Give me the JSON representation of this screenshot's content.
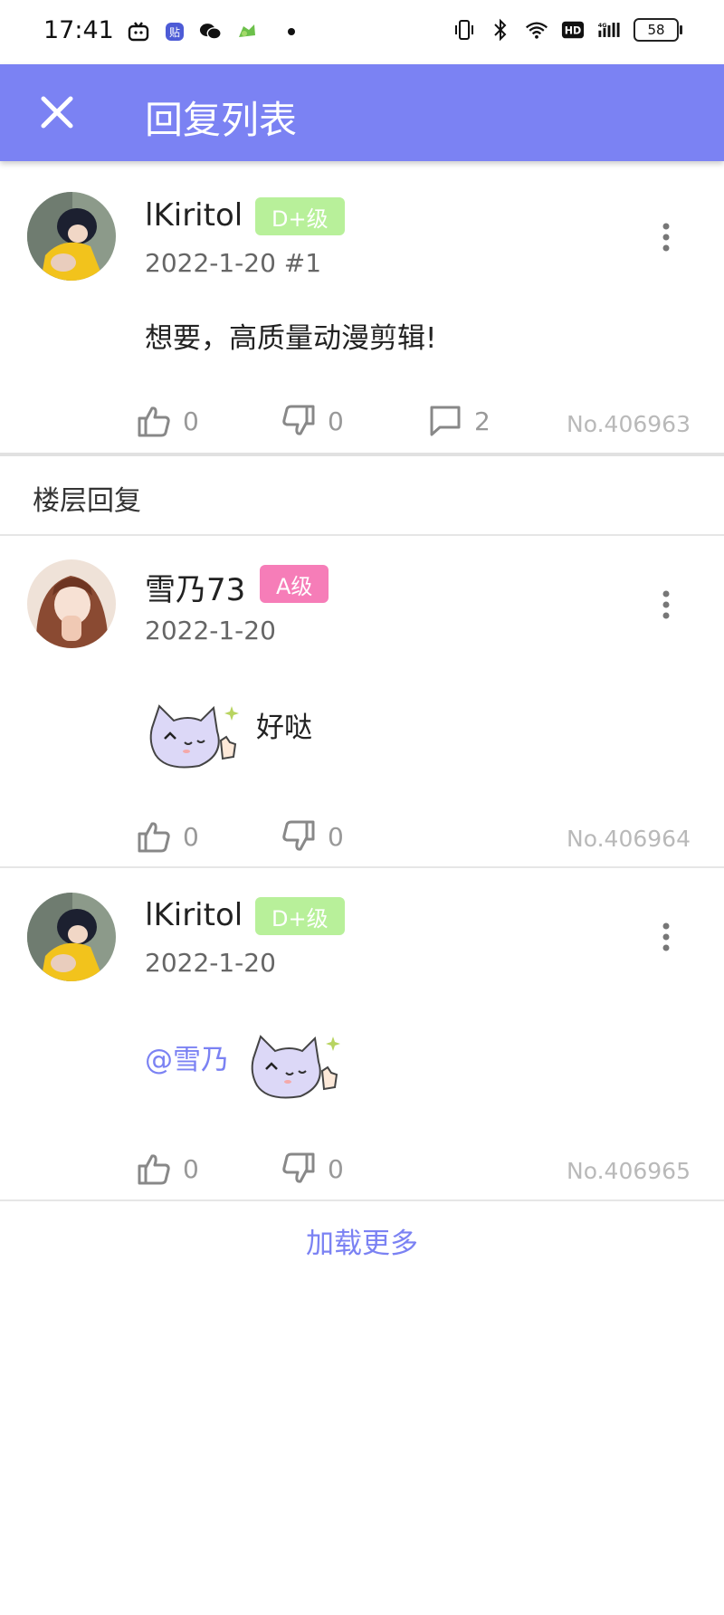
{
  "status_bar": {
    "time": "17:41",
    "battery": "58",
    "icons_left": [
      "tv-app-icon",
      "tieba-icon",
      "wechat-icon",
      "game-icon"
    ],
    "icons_right": [
      "vibrate-icon",
      "bluetooth-icon",
      "wifi-icon",
      "hd-icon",
      "signal-4g-icon",
      "battery-icon"
    ]
  },
  "app_bar": {
    "title": "回复列表",
    "close_icon": "close-icon"
  },
  "main_post": {
    "username": "lKiritol",
    "badge": "D+级",
    "badge_color": "#b8f09a",
    "meta": "2022-1-20 #1",
    "content": "想要，高质量动漫剪辑!",
    "likes": "0",
    "dislikes": "0",
    "comments": "2",
    "number": "No.406963"
  },
  "section": {
    "title": "楼层回复"
  },
  "replies": [
    {
      "username": "雪乃73",
      "badge": "A级",
      "badge_color": "#f67db8",
      "meta": "2022-1-20",
      "content": "好哒",
      "likes": "0",
      "dislikes": "0",
      "number": "No.406964"
    },
    {
      "username": "lKiritol",
      "badge": "D+级",
      "badge_color": "#b8f09a",
      "meta": "2022-1-20",
      "mention": "@雪乃",
      "likes": "0",
      "dislikes": "0",
      "number": "No.406965"
    }
  ],
  "load_more": "加载更多",
  "colors": {
    "accent": "#7b82f3",
    "muted": "#999999"
  }
}
